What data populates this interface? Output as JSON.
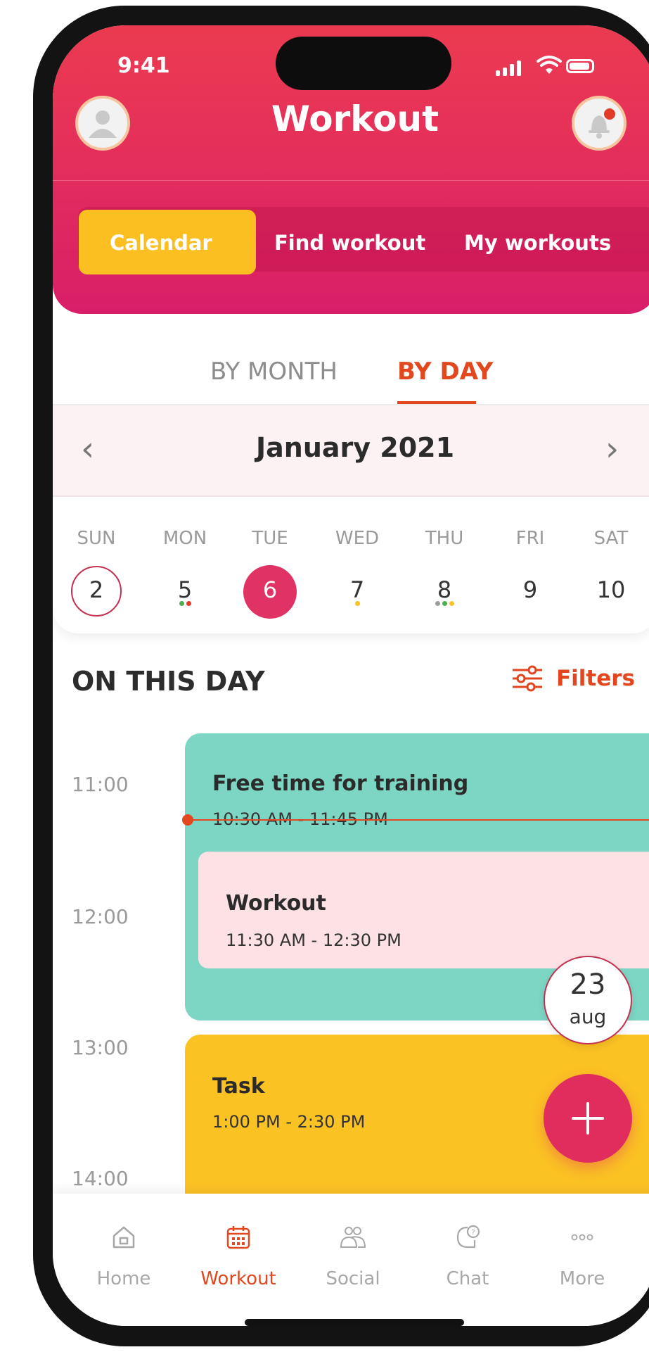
{
  "status_bar": {
    "time": "9:41"
  },
  "header": {
    "title": "Workout"
  },
  "segments": [
    {
      "label": "Calendar",
      "active": true
    },
    {
      "label": "Find workout",
      "active": false
    },
    {
      "label": "My workouts",
      "active": false
    }
  ],
  "view_tabs": [
    {
      "label": "BY MONTH",
      "active": false
    },
    {
      "label": "BY DAY",
      "active": true
    }
  ],
  "month_nav": {
    "title": "January 2021",
    "prev_icon": "chevron-left-icon",
    "next_icon": "chevron-right-icon"
  },
  "week": [
    {
      "name": "SUN",
      "num": "2",
      "state": "outlined",
      "dots": []
    },
    {
      "name": "MON",
      "num": "5",
      "state": "normal",
      "dots": [
        "#4caf50",
        "#e23c29"
      ]
    },
    {
      "name": "TUE",
      "num": "6",
      "state": "selected",
      "dots": []
    },
    {
      "name": "WED",
      "num": "7",
      "state": "normal",
      "dots": [
        "#fbc224"
      ]
    },
    {
      "name": "THU",
      "num": "8",
      "state": "normal",
      "dots": [
        "#9e9e9e",
        "#4caf50",
        "#fbc224"
      ]
    },
    {
      "name": "FRI",
      "num": "9",
      "state": "normal",
      "dots": []
    },
    {
      "name": "SAT",
      "num": "10",
      "state": "normal",
      "dots": []
    }
  ],
  "agenda": {
    "heading": "ON THIS DAY",
    "filters_label": "Filters",
    "times": [
      "11:00",
      "12:00",
      "13:00",
      "14:00"
    ],
    "events": [
      {
        "title": "Free time for training",
        "time": "10:30 AM - 11:45 PM",
        "color": "#7dd5c3"
      },
      {
        "title": "Workout",
        "time": "11:30 AM - 12:30 PM",
        "color": "#fde1e5"
      },
      {
        "title": "Task",
        "time": "1:00 PM - 2:30 PM",
        "color": "#fbc224"
      }
    ],
    "date_bubble": {
      "day": "23",
      "month": "aug"
    }
  },
  "bottom_nav": [
    {
      "label": "Home",
      "icon": "home-icon",
      "active": false
    },
    {
      "label": "Workout",
      "icon": "calendar-icon",
      "active": true
    },
    {
      "label": "Social",
      "icon": "people-icon",
      "active": false
    },
    {
      "label": "Chat",
      "icon": "chat-icon",
      "active": false
    },
    {
      "label": "More",
      "icon": "more-icon",
      "active": false
    }
  ],
  "colors": {
    "accent": "#e2471e",
    "brand": "#e13264",
    "highlight": "#fbbf22"
  }
}
